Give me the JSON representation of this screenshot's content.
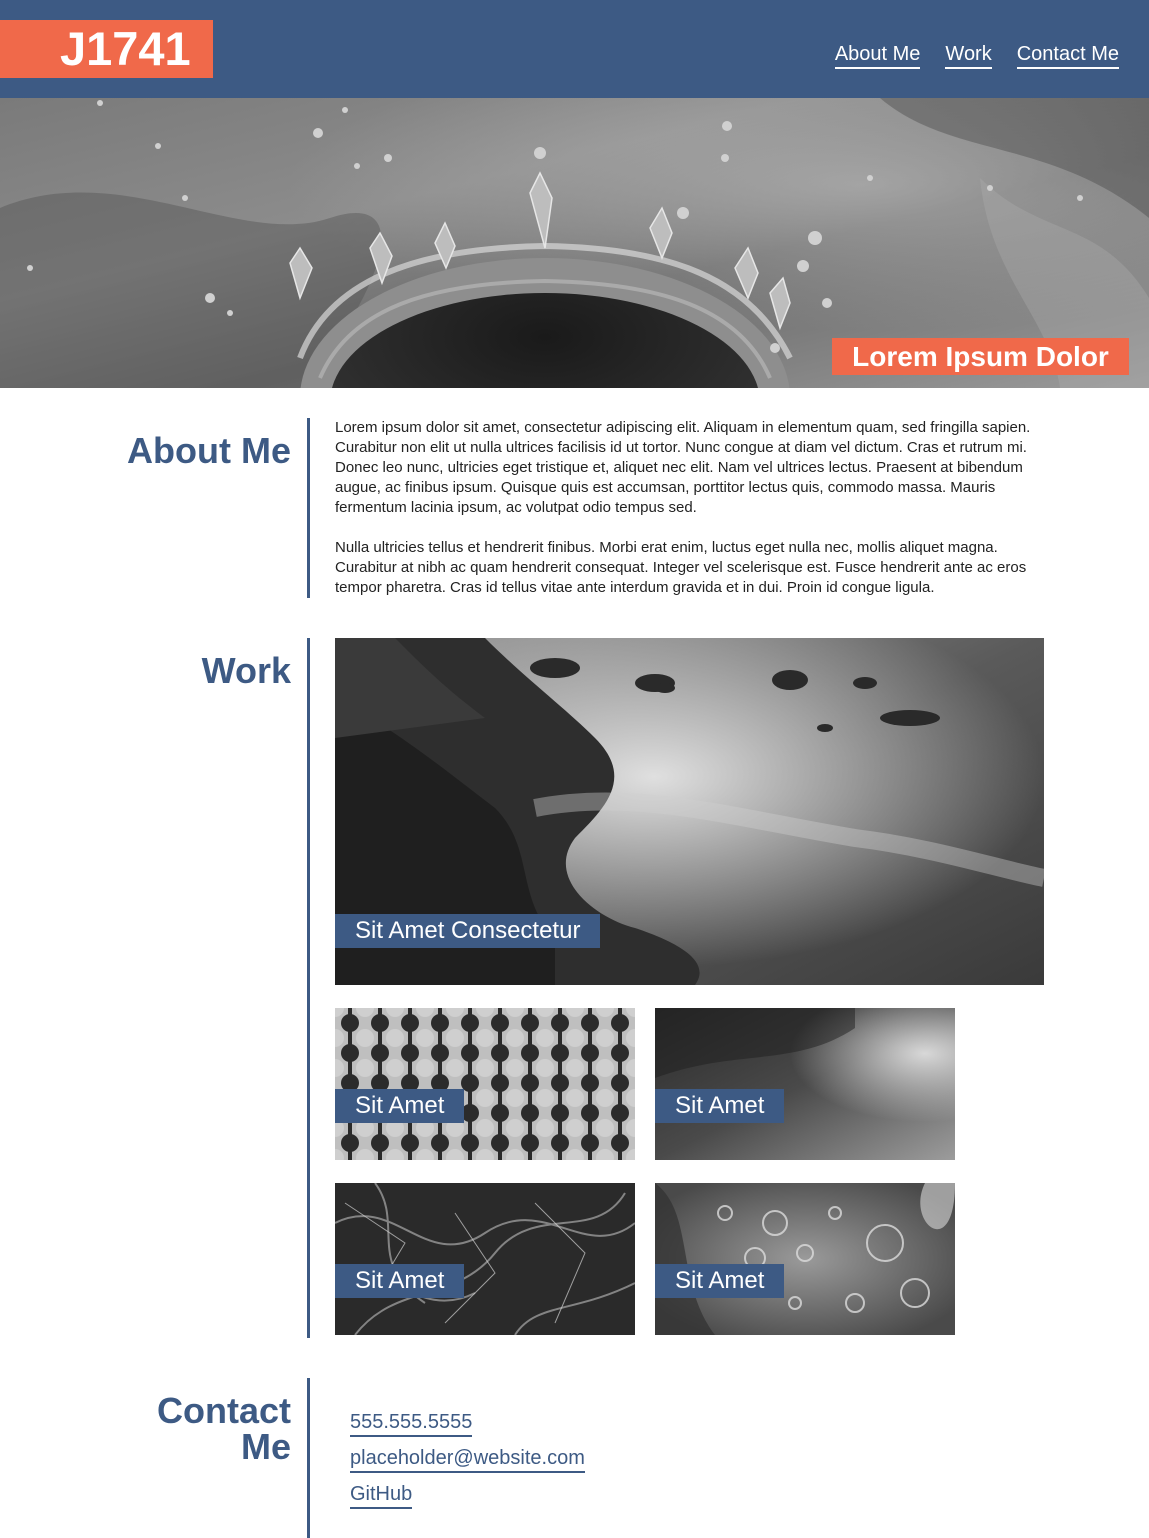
{
  "header": {
    "logo": "J1741",
    "nav": [
      {
        "label": "About Me"
      },
      {
        "label": "Work"
      },
      {
        "label": "Contact Me"
      }
    ]
  },
  "hero": {
    "badge": "Lorem Ipsum Dolor"
  },
  "about": {
    "title": "About Me",
    "paragraphs": [
      "Lorem ipsum dolor sit amet, consectetur adipiscing elit. Aliquam in elementum quam, sed fringilla sapien. Curabitur non elit ut nulla ultrices facilisis id ut tortor. Nunc congue at diam vel dictum. Cras et rutrum mi. Donec leo nunc, ultricies eget tristique et, aliquet nec elit. Nam vel ultrices lectus. Praesent at bibendum augue, ac finibus ipsum. Quisque quis est accumsan, porttitor lectus quis, commodo massa. Mauris fermentum lacinia ipsum, ac volutpat odio tempus sed.",
      "Nulla ultricies tellus et hendrerit finibus. Morbi erat enim, luctus eget nulla nec, mollis aliquet magna. Curabitur at nibh ac quam hendrerit consequat. Integer vel scelerisque est. Fusce hendrerit ante ac eros tempor pharetra. Cras id tellus vitae ante interdum gravida et in dui. Proin id congue ligula."
    ]
  },
  "work": {
    "title": "Work",
    "featured": {
      "label": "Sit Amet Consectetur"
    },
    "items": [
      {
        "label": "Sit Amet"
      },
      {
        "label": "Sit Amet"
      },
      {
        "label": "Sit Amet"
      },
      {
        "label": "Sit Amet"
      }
    ]
  },
  "contact": {
    "title_line1": "Contact",
    "title_line2": "Me",
    "links": [
      {
        "label": "555.555.5555"
      },
      {
        "label": "placeholder@website.com"
      },
      {
        "label": "GitHub"
      }
    ]
  },
  "colors": {
    "primary": "#3d5a84",
    "accent": "#f0694a"
  }
}
